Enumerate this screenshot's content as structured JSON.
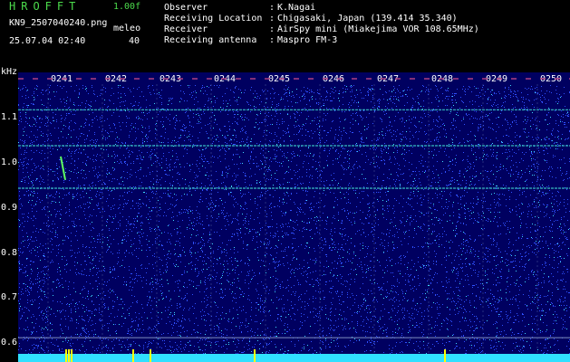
{
  "header": {
    "brand": "HROFFT",
    "version": "1.00f",
    "filename": "KN9_2507040240.png",
    "datetime": "25.07.04 02:40",
    "meleo_label": "meleo",
    "meleo_value": "40"
  },
  "info": [
    {
      "key": "Observer",
      "value": "K.Nagai"
    },
    {
      "key": "Receiving Location",
      "value": "Chigasaki, Japan (139.414 35.340)"
    },
    {
      "key": "Receiver",
      "value": "AirSpy mini (Miakejima VOR 108.65MHz)"
    },
    {
      "key": "Receiving antenna",
      "value": "Maspro FM-3"
    }
  ],
  "info_sep": ":",
  "spectrogram": {
    "y_unit": "kHz",
    "y_ticks": [
      "1.1",
      "1.0",
      "0.9",
      "0.8",
      "0.7",
      "0.6"
    ],
    "y_range": [
      0.57,
      1.19
    ],
    "time_labels": [
      "0241",
      "0242",
      "0243",
      "0244",
      "0245",
      "0246",
      "0247",
      "0248",
      "0249",
      "0250"
    ],
    "colors": {
      "background": "#000060",
      "noise": "#3050ff",
      "line": "#40e0d0",
      "grid": "#8090c0"
    }
  }
}
